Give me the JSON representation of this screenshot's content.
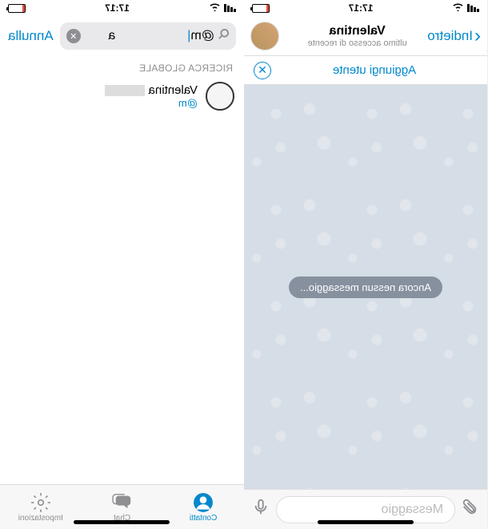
{
  "status": {
    "time": "17:17"
  },
  "chat": {
    "back": "Indietro",
    "name": "Valentina",
    "last_seen": "ultimo accesso di recente",
    "add_user": "Aggiungi utente",
    "no_messages": "Ancora nessun messaggio...",
    "placeholder": "Messaggio"
  },
  "search": {
    "query": "@m",
    "query_suffix": "a",
    "cancel": "Annulla",
    "section": "RICERCA GLOBALE",
    "result": {
      "name": "Valentina",
      "handle": "@m"
    }
  },
  "tabs": {
    "contacts": "Contatti",
    "chat": "Chat",
    "settings": "Impostazioni"
  }
}
